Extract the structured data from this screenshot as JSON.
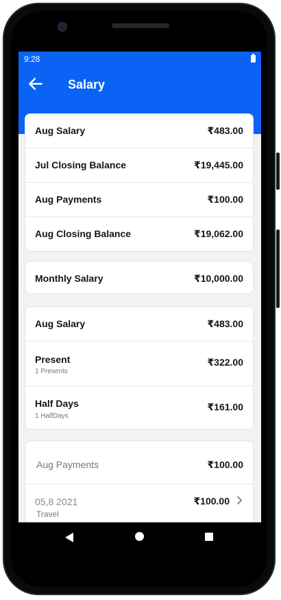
{
  "status_bar": {
    "time": "9:28"
  },
  "app_bar": {
    "title": "Salary"
  },
  "summary": [
    {
      "label": "Aug Salary",
      "value": "₹483.00"
    },
    {
      "label": "Jul Closing Balance",
      "value": "₹19,445.00"
    },
    {
      "label": "Aug Payments",
      "value": "₹100.00"
    },
    {
      "label": "Aug Closing Balance",
      "value": "₹19,062.00"
    }
  ],
  "monthly": {
    "label": "Monthly Salary",
    "value": "₹10,000.00"
  },
  "breakdown": [
    {
      "label": "Aug Salary",
      "value": "₹483.00",
      "sub": ""
    },
    {
      "label": "Present",
      "value": "₹322.00",
      "sub": "1 Presents"
    },
    {
      "label": "Half Days",
      "value": "₹161.00",
      "sub": "1 HalfDays"
    }
  ],
  "payments": {
    "header_label": "Aug Payments",
    "header_value": "₹100.00",
    "items": [
      {
        "date": "05,8 2021",
        "category": "Travel",
        "amount": "₹100.00"
      }
    ]
  },
  "icons": {
    "back": "arrow-left-icon",
    "chevron": "chevron-right-icon",
    "battery": "battery-icon",
    "nav_back": "triangle-back-icon",
    "nav_home": "circle-home-icon",
    "nav_recents": "square-recents-icon"
  },
  "colors": {
    "accent": "#0a63f5",
    "background": "#f2f2f2",
    "card": "#ffffff"
  }
}
